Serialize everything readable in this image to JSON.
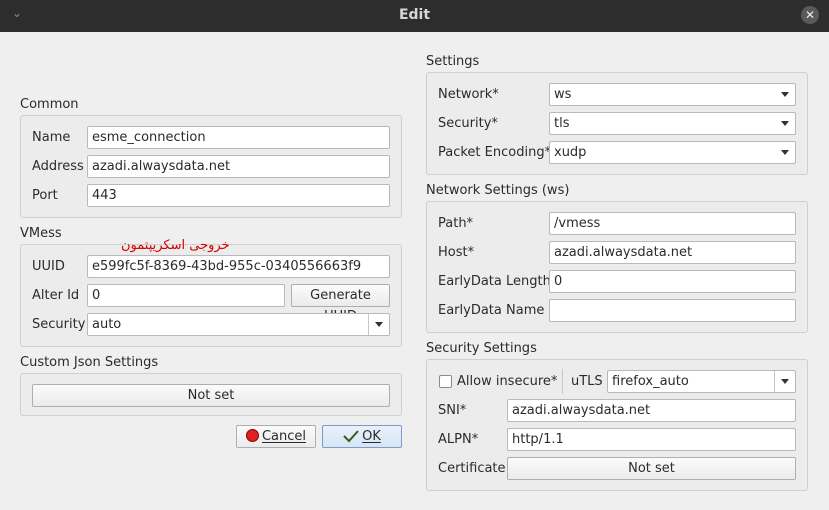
{
  "window": {
    "title": "Edit"
  },
  "left": {
    "common": {
      "title": "Common",
      "name_label": "Name",
      "name_value": "esme_connection",
      "address_label": "Address",
      "address_value": "azadi.alwaysdata.net",
      "port_label": "Port",
      "port_value": "443"
    },
    "vmess": {
      "title": "VMess",
      "overlay_text": "خروجی اسکریپتمون",
      "uuid_label": "UUID",
      "uuid_value": "e599fc5f-8369-43bd-955c-0340556663f9",
      "alterid_label": "Alter Id",
      "alterid_value": "0",
      "generate_uuid_label": "Generate UUID",
      "security_label": "Security",
      "security_value": "auto"
    },
    "custom_json": {
      "title": "Custom Json Settings",
      "button_label": "Not set"
    },
    "buttons": {
      "cancel_label": "Cancel",
      "ok_label": "OK"
    }
  },
  "right": {
    "settings": {
      "title": "Settings",
      "network_label": "Network*",
      "network_value": "ws",
      "security_label": "Security*",
      "security_value": "tls",
      "packet_label": "Packet Encoding*",
      "packet_value": "xudp"
    },
    "network_settings": {
      "title": "Network Settings (ws)",
      "path_label": "Path*",
      "path_value": "/vmess",
      "host_label": "Host*",
      "host_value": "azadi.alwaysdata.net",
      "early_len_label": "EarlyData Length",
      "early_len_value": "0",
      "early_name_label": "EarlyData Name",
      "early_name_value": ""
    },
    "security_settings": {
      "title": "Security Settings",
      "allow_insecure_label": "Allow insecure*",
      "utls_label": "uTLS",
      "utls_value": "firefox_auto",
      "sni_label": "SNI*",
      "sni_value": "azadi.alwaysdata.net",
      "alpn_label": "ALPN*",
      "alpn_value": "http/1.1",
      "cert_label": "Certificate",
      "cert_button_label": "Not set"
    }
  }
}
